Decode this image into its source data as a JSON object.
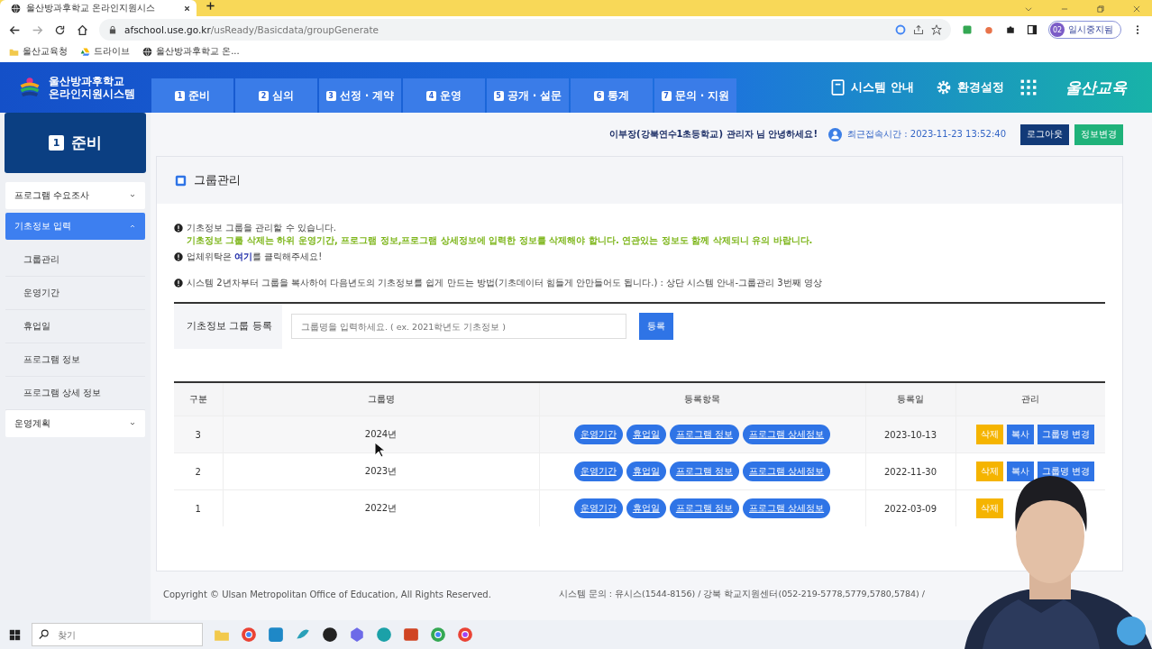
{
  "browser": {
    "tab_title": "울산방과후학교 온라인지원시스",
    "url_host": "afschool.use.go.kr",
    "url_path": "/usReady/Basicdata/groupGenerate",
    "profile_badge": "02",
    "profile_name": "일시중지됨",
    "bookmarks": [
      {
        "kind": "folder",
        "label": "울산교육청"
      },
      {
        "kind": "drive",
        "label": "드라이브"
      },
      {
        "kind": "globe",
        "label": "울산방과후학교 온..."
      }
    ]
  },
  "header": {
    "logo_lines": [
      "울산방과후학교",
      "온라인지원시스템"
    ],
    "nav": [
      {
        "num": "1",
        "label": "준비",
        "selected": false
      },
      {
        "num": "2",
        "label": "심의",
        "selected": false
      },
      {
        "num": "3",
        "label": "선정 · 계약",
        "selected": false
      },
      {
        "num": "4",
        "label": "운영",
        "selected": false
      },
      {
        "num": "5",
        "label": "공개 · 설문",
        "selected": false
      },
      {
        "num": "6",
        "label": "통계",
        "selected": false
      },
      {
        "num": "7",
        "label": "문의 · 지원",
        "selected": false
      }
    ],
    "links": [
      {
        "kind": "book",
        "label": "시스템 안내"
      },
      {
        "kind": "gear",
        "label": "환경설정"
      }
    ],
    "brand": "울산교육"
  },
  "sidebar": {
    "section_num": "1",
    "section_title": "준비",
    "menu": [
      {
        "label": "프로그램 수요조사",
        "expanded": false,
        "selected": false
      },
      {
        "label": "기초정보 입력",
        "expanded": true,
        "selected": true,
        "children": [
          {
            "label": "그룹관리"
          },
          {
            "label": "운영기간"
          },
          {
            "label": "휴업일"
          },
          {
            "label": "프로그램 정보"
          },
          {
            "label": "프로그램 상세 정보"
          }
        ]
      },
      {
        "label": "운영계획",
        "expanded": false,
        "selected": false
      }
    ]
  },
  "user_bar": {
    "greeting": "이부장(강북연수1초등학교) 관리자 님 안녕하세요!",
    "last_login": "최근접속시간 : 2023-11-23 13:52:40",
    "buttons": [
      {
        "kind": "dark",
        "label": "로그아웃"
      },
      {
        "kind": "green",
        "label": "정보변경"
      }
    ]
  },
  "panel": {
    "title": "그룹관리",
    "notices": [
      {
        "kind": "note",
        "text": "기초정보 그룹을 관리할 수 있습니다."
      },
      {
        "kind": "warning",
        "text": "기초정보 그룹 삭제는 하위 운영기간, 프로그램 정보,프로그램 상세정보에 입력한 정보를 삭제해야 합니다. 연관있는 정보도 함께 삭제되니 유의 바랍니다."
      },
      {
        "kind": "link_note",
        "before": "업체위탁은 ",
        "link": "여기",
        "after": "를 클릭해주세요!"
      },
      {
        "kind": "note",
        "text": "시스템 2년차부터 그룹을 복사하여 다음년도의 기초정보를 쉽게 만드는 방법(기초데이터 힘들게 안만들어도 됩니다.) : 상단 시스템 안내-그룹관리 3번째 영상"
      }
    ],
    "form": {
      "label": "기초정보 그룹 등록",
      "placeholder": "그룹명을 입력하세요. ( ex. 2021학년도 기초정보 )",
      "button": "등록"
    },
    "table": {
      "columns": [
        "구분",
        "그룹명",
        "등록항목",
        "등록일",
        "관리"
      ],
      "rows": [
        {
          "no": "3",
          "name": "2024년",
          "items": [
            "운영기간",
            "휴업일",
            "프로그램 정보",
            "프로그램 상세정보"
          ],
          "date": "2023-10-13",
          "actions": [
            {
              "kind": "delete",
              "label": "삭제"
            },
            {
              "kind": "copy",
              "label": "복사"
            },
            {
              "kind": "rename",
              "label": "그룹명 변경"
            }
          ]
        },
        {
          "no": "2",
          "name": "2023년",
          "items": [
            "운영기간",
            "휴업일",
            "프로그램 정보",
            "프로그램 상세정보"
          ],
          "date": "2022-11-30",
          "actions": [
            {
              "kind": "delete",
              "label": "삭제"
            },
            {
              "kind": "copy",
              "label": "복사"
            },
            {
              "kind": "rename",
              "label": "그룹명 변경"
            }
          ]
        },
        {
          "no": "1",
          "name": "2022년",
          "items": [
            "운영기간",
            "휴업일",
            "프로그램 정보",
            "프로그램 상세정보"
          ],
          "date": "2022-03-09",
          "actions": [
            {
              "kind": "delete",
              "label": "삭제"
            }
          ]
        }
      ]
    }
  },
  "footer": {
    "copyright": "Copyright © Ulsan Metropolitan Office of Education, All Rights Reserved.",
    "contact": "시스템 문의 : 유시스(1544-8156) / 강북 학교지원센터(052-219-5778,5779,5780,5784) /"
  },
  "taskbar": {
    "search_placeholder": "찾기"
  }
}
